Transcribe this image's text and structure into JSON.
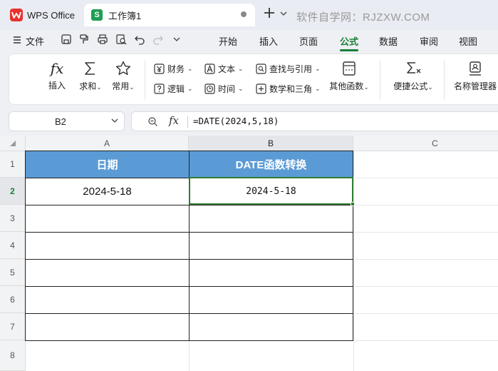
{
  "titlebar": {
    "app_tab": "WPS Office",
    "doc_tab": "工作簿1",
    "sheet_badge": "S",
    "watermark": "软件自学网：RJZXW.COM"
  },
  "menubar": {
    "file": "文件",
    "tabs": [
      "开始",
      "插入",
      "页面",
      "公式",
      "数据",
      "审阅",
      "视图"
    ],
    "active_tab": "公式"
  },
  "ribbon": {
    "insert_fn": "插入",
    "autosum": "求和",
    "common": "常用",
    "finance": "财务",
    "logic": "逻辑",
    "text": "文本",
    "time": "时间",
    "lookup": "查找与引用",
    "math": "数学和三角",
    "other": "其他函数",
    "quick_formula": "便捷公式",
    "name_manager": "名称管理器",
    "fx_symbol": "fx"
  },
  "formula_bar": {
    "cell_ref": "B2",
    "fx_label": "fx",
    "formula": "=DATE(2024,5,18)"
  },
  "sheet": {
    "columns": [
      "A",
      "B",
      "C"
    ],
    "rows": [
      "1",
      "2",
      "3",
      "4",
      "5",
      "6",
      "7",
      "8"
    ],
    "header_a": "日期",
    "header_b": "DATE函数转换",
    "a2": "2024-5-18",
    "b2": "2024-5-18"
  },
  "colors": {
    "accent_green": "#1a7f37",
    "header_blue": "#5b9bd5",
    "selection": "#2e7d32"
  }
}
